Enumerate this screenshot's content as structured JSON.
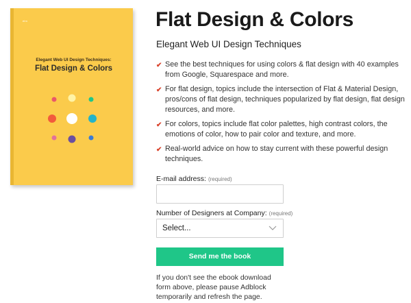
{
  "book": {
    "logo": "elm",
    "subtitle": "Elegant Web UI Design Techniques:",
    "title": "Flat Design & Colors",
    "cover_color": "#fbcb4b",
    "dot_colors": [
      "#e9586a",
      "#fff3a6",
      "#1fc688",
      "#f25a3c",
      "#ffffff",
      "#24b3c9",
      "#e2729a",
      "#6b4fa0",
      "#3b7bd4"
    ]
  },
  "heading": {
    "title": "Flat Design & Colors",
    "subtitle": "Elegant Web UI Design Techniques"
  },
  "features": [
    "See the best techniques for using colors & flat design with 40 examples from Google, Squarespace and more.",
    "For flat design, topics include the intersection of Flat & Material Design, pros/cons of flat design, techniques popularized by flat design, flat design resources, and more.",
    "For colors, topics include flat color palettes, high contrast colors, the emotions of color, how to pair color and texture, and more.",
    "Real-world advice on how to stay current with these powerful design techniques."
  ],
  "form": {
    "email_label": "E-mail address:",
    "email_required": "(required)",
    "designers_label": "Number of Designers at Company:",
    "designers_required": "(required)",
    "designers_selected": "Select...",
    "submit_label": "Send me the book"
  },
  "note": "If you don't see the ebook download form above, please pause Adblock temporarily and refresh the page. Thanks!",
  "icons": {
    "bullet": "check-icon",
    "dropdown": "chevron-down-icon"
  },
  "colors": {
    "accent": "#1fc688",
    "check": "#d9432c"
  }
}
